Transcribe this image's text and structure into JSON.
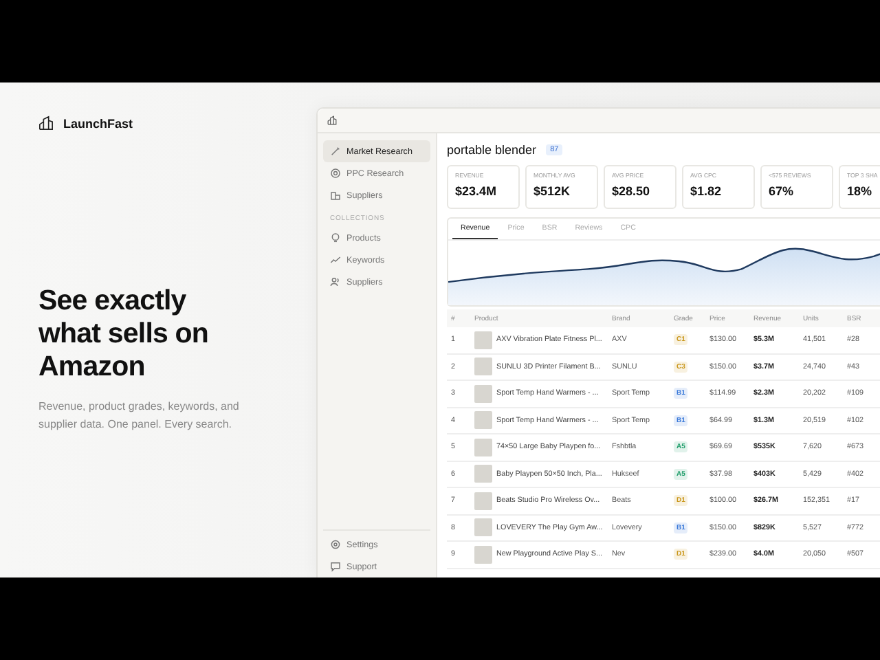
{
  "brand": {
    "name": "LaunchFast"
  },
  "hero": {
    "headline": "See exactly what sells on Amazon",
    "description": "Revenue, product grades, keywords, and supplier data. One panel. Every search."
  },
  "sidebar": {
    "items": [
      {
        "label": "Market Research",
        "selected": true
      },
      {
        "label": "PPC Research",
        "selected": false
      },
      {
        "label": "Suppliers",
        "selected": false
      }
    ],
    "section_label": "COLLECTIONS",
    "collections": [
      {
        "label": "Products",
        "selected": false
      },
      {
        "label": "Keywords",
        "selected": false
      },
      {
        "label": "Suppliers",
        "selected": false
      }
    ],
    "footer_items": [
      {
        "label": "Settings"
      },
      {
        "label": "Support"
      }
    ]
  },
  "search": {
    "query": "portable blender",
    "count": "87"
  },
  "stats": [
    {
      "label": "REVENUE",
      "value": "$23.4M"
    },
    {
      "label": "MONTHLY AVG",
      "value": "$512K"
    },
    {
      "label": "AVG PRICE",
      "value": "$28.50"
    },
    {
      "label": "AVG CPC",
      "value": "$1.82"
    },
    {
      "label": "<575 REVIEWS",
      "value": "67%"
    },
    {
      "label": "TOP 3 SHA",
      "value": "18%"
    }
  ],
  "chart_tabs": [
    {
      "label": "Revenue",
      "selected": true
    },
    {
      "label": "Price",
      "selected": false
    },
    {
      "label": "BSR",
      "selected": false
    },
    {
      "label": "Reviews",
      "selected": false
    },
    {
      "label": "CPC",
      "selected": false
    }
  ],
  "table": {
    "columns": [
      "#",
      "Product",
      "Brand",
      "Grade",
      "Price",
      "Revenue",
      "Units",
      "BSR"
    ],
    "rows": [
      {
        "rank": "1",
        "product": "AXV Vibration Plate Fitness Pl...",
        "brand": "AXV",
        "grade": {
          "text": "C1",
          "color": "#c9961a"
        },
        "price": "$130.00",
        "revenue": "$5.3M",
        "units": "41,501",
        "bsr": "#28"
      },
      {
        "rank": "2",
        "product": "SUNLU 3D Printer Filament B...",
        "brand": "SUNLU",
        "grade": {
          "text": "C3",
          "color": "#c9961a"
        },
        "price": "$150.00",
        "revenue": "$3.7M",
        "units": "24,740",
        "bsr": "#43"
      },
      {
        "rank": "3",
        "product": "Sport Temp Hand Warmers - ...",
        "brand": "Sport Temp",
        "grade": {
          "text": "B1",
          "color": "#3b7ad9"
        },
        "price": "$114.99",
        "revenue": "$2.3M",
        "units": "20,202",
        "bsr": "#109"
      },
      {
        "rank": "4",
        "product": "Sport Temp Hand Warmers - ...",
        "brand": "Sport Temp",
        "grade": {
          "text": "B1",
          "color": "#3b7ad9"
        },
        "price": "$64.99",
        "revenue": "$1.3M",
        "units": "20,519",
        "bsr": "#102"
      },
      {
        "rank": "5",
        "product": "74×50 Large Baby Playpen fo...",
        "brand": "Fshbtla",
        "grade": {
          "text": "A5",
          "color": "#1f9d6a"
        },
        "price": "$69.69",
        "revenue": "$535K",
        "units": "7,620",
        "bsr": "#673"
      },
      {
        "rank": "6",
        "product": "Baby Playpen 50×50 Inch, Pla...",
        "brand": "Hukseef",
        "grade": {
          "text": "A5",
          "color": "#1f9d6a"
        },
        "price": "$37.98",
        "revenue": "$403K",
        "units": "5,429",
        "bsr": "#402"
      },
      {
        "rank": "7",
        "product": "Beats Studio Pro Wireless Ov...",
        "brand": "Beats",
        "grade": {
          "text": "D1",
          "color": "#c9961a"
        },
        "price": "$100.00",
        "revenue": "$26.7M",
        "units": "152,351",
        "bsr": "#17"
      },
      {
        "rank": "8",
        "product": "LOVEVERY The Play Gym Aw...",
        "brand": "Lovevery",
        "grade": {
          "text": "B1",
          "color": "#3b7ad9"
        },
        "price": "$150.00",
        "revenue": "$829K",
        "units": "5,527",
        "bsr": "#772"
      },
      {
        "rank": "9",
        "product": "New Playground Active Play S...",
        "brand": "Nev",
        "grade": {
          "text": "D1",
          "color": "#c9961a"
        },
        "price": "$239.00",
        "revenue": "$4.0M",
        "units": "20,050",
        "bsr": "#507"
      }
    ]
  }
}
